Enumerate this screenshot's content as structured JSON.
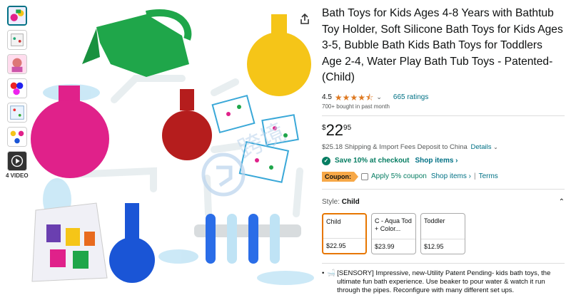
{
  "thumbnails": [
    {
      "name": "thumb-1",
      "selected": true
    },
    {
      "name": "thumb-2"
    },
    {
      "name": "thumb-3"
    },
    {
      "name": "thumb-4"
    },
    {
      "name": "thumb-5"
    },
    {
      "name": "thumb-6"
    },
    {
      "name": "thumb-video"
    }
  ],
  "video_label": "4 VIDEO",
  "product": {
    "title": "Bath Toys for Kids Ages 4-8 Years with Bathtub Toy Holder, Soft Silicone Bath Toys for Kids Ages 3-5, Bubble Bath Kids Bath Toys for Toddlers Age 2-4, Water Play Bath Tub Toys - Patented- (Child)",
    "rating": "4.5",
    "ratings_count": "665 ratings",
    "bought": "700+ bought in past month",
    "price_currency": "$",
    "price_whole": "22",
    "price_fraction": "95",
    "shipping": "$25.18 Shipping & Import Fees Deposit to China",
    "shipping_link": "Details",
    "save_text": "Save 10% at checkout",
    "shop_items": "Shop items ›",
    "coupon_label": "Coupon:",
    "coupon_apply": "Apply 5% coupon",
    "coupon_shop": "Shop items ›",
    "coupon_sep": "|",
    "terms": "Terms"
  },
  "style": {
    "label": "Style:",
    "value": "Child",
    "options": [
      {
        "name": "Child",
        "price": "$22.95",
        "selected": true
      },
      {
        "name": "C - Aqua Tod + Color...",
        "price": "$23.99"
      },
      {
        "name": "Toddler",
        "price": "$12.95"
      }
    ]
  },
  "bullet": "[SENSORY] Impressive, new-Utility Patent Pending- kids bath toys, the ultimate fun bath experience. Use beaker to pour water & watch it run through the pipes. Reconfigure with many different set ups.",
  "colors": {
    "link": "#007185",
    "green": "#067d62",
    "star": "#de7921",
    "coupon": "#f7a847",
    "selected_border": "#e77600"
  }
}
